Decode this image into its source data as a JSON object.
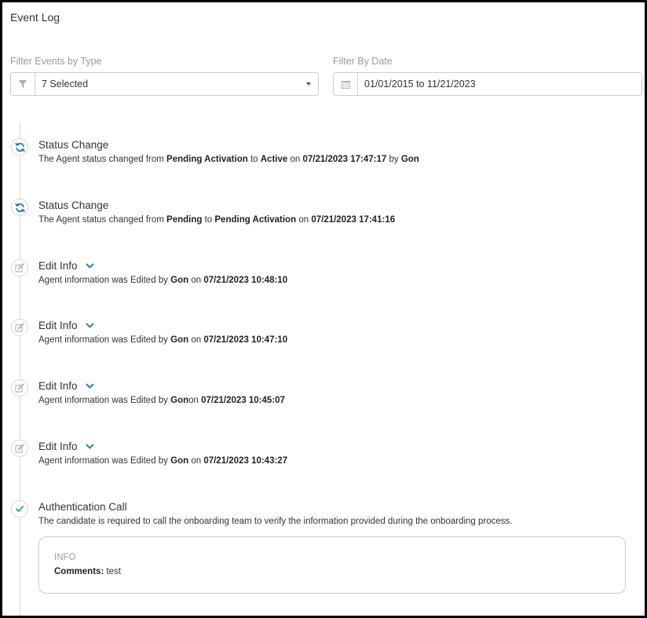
{
  "title": "Event Log",
  "filters": {
    "type": {
      "label": "Filter Events by Type",
      "value": "7 Selected",
      "icon": "filter-icon"
    },
    "date": {
      "label": "Filter By Date",
      "value": "01/01/2015 to 11/21/2023",
      "icon": "calendar-icon"
    }
  },
  "colors": {
    "accent": "#2a7fb8",
    "success": "#2bb673",
    "muted_icon": "#b5b5b5",
    "timeline": "#d9d9d9"
  },
  "events": [
    {
      "type": "status",
      "icon": "sync-icon",
      "title": "Status Change",
      "parts": [
        {
          "t": "The Agent status changed from ",
          "b": false
        },
        {
          "t": "Pending Activation",
          "b": true
        },
        {
          "t": " to ",
          "b": false
        },
        {
          "t": "Active",
          "b": true
        },
        {
          "t": " on ",
          "b": false
        },
        {
          "t": "07/21/2023 17:47:17",
          "b": true
        },
        {
          "t": " by ",
          "b": false
        },
        {
          "t": "Gon",
          "b": true
        }
      ]
    },
    {
      "type": "status",
      "icon": "sync-icon",
      "title": "Status Change",
      "parts": [
        {
          "t": "The Agent status changed from ",
          "b": false
        },
        {
          "t": "Pending",
          "b": true
        },
        {
          "t": " to ",
          "b": false
        },
        {
          "t": "Pending Activation",
          "b": true
        },
        {
          "t": " on ",
          "b": false
        },
        {
          "t": "07/21/2023 17:41:16",
          "b": true
        }
      ]
    },
    {
      "type": "edit",
      "icon": "edit-icon",
      "title": "Edit Info",
      "parts": [
        {
          "t": "Agent information was Edited by ",
          "b": false
        },
        {
          "t": "Gon",
          "b": true
        },
        {
          "t": " on ",
          "b": false
        },
        {
          "t": "07/21/2023 10:48:10",
          "b": true
        }
      ]
    },
    {
      "type": "edit",
      "icon": "edit-icon",
      "title": "Edit Info",
      "parts": [
        {
          "t": "Agent information was Edited by ",
          "b": false
        },
        {
          "t": "Gon",
          "b": true
        },
        {
          "t": " on ",
          "b": false
        },
        {
          "t": "07/21/2023 10:47:10",
          "b": true
        }
      ]
    },
    {
      "type": "edit",
      "icon": "edit-icon",
      "title": "Edit Info",
      "parts": [
        {
          "t": "Agent information was Edited by ",
          "b": false
        },
        {
          "t": "Gon",
          "b": true
        },
        {
          "t": "on ",
          "b": false
        },
        {
          "t": "07/21/2023 10:45:07",
          "b": true
        }
      ]
    },
    {
      "type": "edit",
      "icon": "edit-icon",
      "title": "Edit Info",
      "parts": [
        {
          "t": "Agent information was Edited by ",
          "b": false
        },
        {
          "t": "Gon",
          "b": true
        },
        {
          "t": " on ",
          "b": false
        },
        {
          "t": "07/21/2023 10:43:27",
          "b": true
        }
      ]
    },
    {
      "type": "auth",
      "icon": "check-icon",
      "title": "Authentication Call",
      "parts": [
        {
          "t": "The candidate is required to call the onboarding team to verify the information provided during the onboarding process.",
          "b": false
        }
      ],
      "info": {
        "heading": "INFO",
        "comment_label": "Comments:",
        "comment_value": " test"
      }
    }
  ]
}
